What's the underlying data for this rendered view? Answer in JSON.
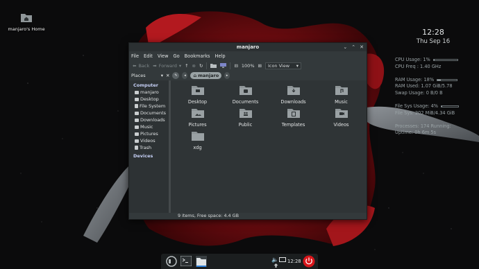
{
  "desktop": {
    "home_icon_label": "manjaro's Home"
  },
  "conky": {
    "time": "12:28",
    "date": "Thu Sep 16",
    "cpu_usage": "CPU Usage: 1%",
    "cpu_usage_fraction": 0.01,
    "cpu_freq": "CPU Freq : 1.40 GHz",
    "ram_usage": "RAM Usage: 18%",
    "ram_usage_fraction": 0.18,
    "ram_used": "RAM Used: 1.07 GiB/5.78",
    "swap_usage": "Swap Usage: 0 B/0 B",
    "fs_usage": "File Sys Usage:  4%",
    "fs_usage_fraction": 0.04,
    "fs": "File Sys: 202 MiB/4.34 GiB",
    "processes": "Processes: 174   Running:",
    "uptime": "Uptime: 0h 6m 5s"
  },
  "window": {
    "title": "manjaro",
    "menu": [
      "File",
      "Edit",
      "View",
      "Go",
      "Bookmarks",
      "Help"
    ],
    "toolbar": {
      "back": "Back",
      "forward": "Forward",
      "zoom": "100%",
      "view_mode": "Icon View"
    },
    "location": {
      "places_label": "Places",
      "path_current": "manjaro"
    },
    "sidebar": {
      "computer_header": "Computer",
      "computer_items": [
        "manjaro",
        "Desktop",
        "File System",
        "Documents",
        "Downloads",
        "Music",
        "Pictures",
        "Videos",
        "Trash"
      ],
      "devices_header": "Devices"
    },
    "files": [
      {
        "name": "Desktop",
        "icon": "desktop-folder-icon"
      },
      {
        "name": "Documents",
        "icon": "documents-folder-icon"
      },
      {
        "name": "Downloads",
        "icon": "downloads-folder-icon"
      },
      {
        "name": "Music",
        "icon": "music-folder-icon"
      },
      {
        "name": "Pictures",
        "icon": "pictures-folder-icon"
      },
      {
        "name": "Public",
        "icon": "public-folder-icon"
      },
      {
        "name": "Templates",
        "icon": "templates-folder-icon"
      },
      {
        "name": "Videos",
        "icon": "videos-folder-icon"
      },
      {
        "name": "xdg",
        "icon": "folder-icon"
      }
    ],
    "status": "9 items, Free space: 4.4 GB"
  },
  "taskbar": {
    "clock": "12:28"
  },
  "colors": {
    "accent_red": "#d8161b",
    "folder_gray": "#8f9699",
    "window_bg": "#33393b"
  }
}
